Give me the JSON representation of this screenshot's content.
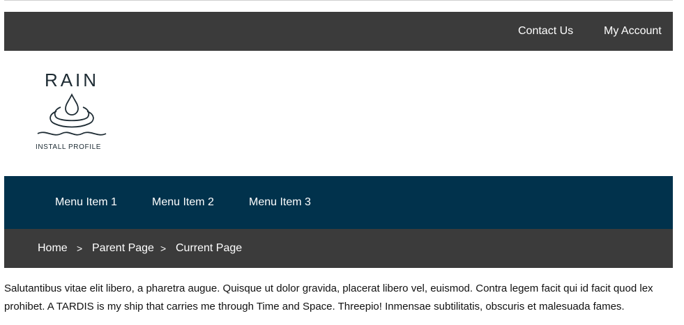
{
  "utility_nav": {
    "contact_label": "Contact Us",
    "account_label": "My Account"
  },
  "logo": {
    "wordmark": "RAIN",
    "caption": "INSTALL PROFILE",
    "icon": "water-drop-icon"
  },
  "main_nav": {
    "items": [
      {
        "label": "Menu Item 1"
      },
      {
        "label": "Menu Item 2"
      },
      {
        "label": "Menu Item 3"
      }
    ]
  },
  "breadcrumb": {
    "separator": ">",
    "items": [
      {
        "label": "Home"
      },
      {
        "label": "Parent Page"
      },
      {
        "label": "Current Page"
      }
    ]
  },
  "content": {
    "paragraph": "Salutantibus vitae elit libero, a pharetra augue. Quisque ut dolor gravida, placerat libero vel, euismod. Contra legem facit qui id facit quod lex prohibet. A TARDIS is my ship that carries me through Time and Space. Threepio! Inmensae subtilitatis, obscuris et malesuada fames."
  },
  "colors": {
    "utility_bar": "#3b3b3b",
    "main_nav": "#01324c",
    "breadcrumb_bar": "#3b3b3b",
    "logo_ink": "#1d2b33"
  }
}
